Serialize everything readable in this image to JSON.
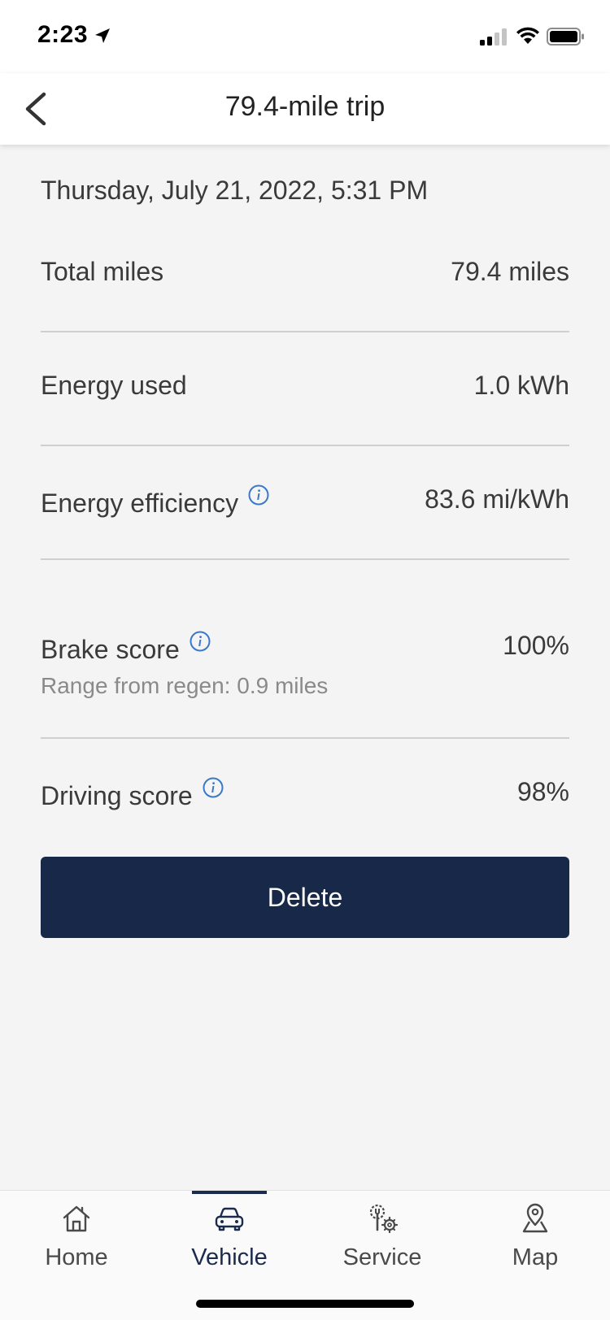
{
  "status_bar": {
    "time": "2:23"
  },
  "header": {
    "title": "79.4-mile trip"
  },
  "trip": {
    "date": "Thursday, July 21, 2022, 5:31 PM",
    "rows": [
      {
        "label": "Total miles",
        "value": "79.4 miles"
      },
      {
        "label": "Energy used",
        "value": "1.0 kWh"
      },
      {
        "label": "Energy efficiency",
        "value": "83.6 mi/kWh"
      },
      {
        "label": "Brake score",
        "value": "100%",
        "sub": "Range from regen: 0.9 miles"
      },
      {
        "label": "Driving score",
        "value": "98%"
      }
    ]
  },
  "actions": {
    "delete_label": "Delete"
  },
  "tabs": [
    {
      "label": "Home",
      "icon": "home-icon"
    },
    {
      "label": "Vehicle",
      "icon": "car-icon"
    },
    {
      "label": "Service",
      "icon": "service-gear-icon"
    },
    {
      "label": "Map",
      "icon": "map-pin-icon"
    }
  ],
  "colors": {
    "accent": "#172849",
    "info": "#3b78c9",
    "background": "#f4f4f4"
  }
}
